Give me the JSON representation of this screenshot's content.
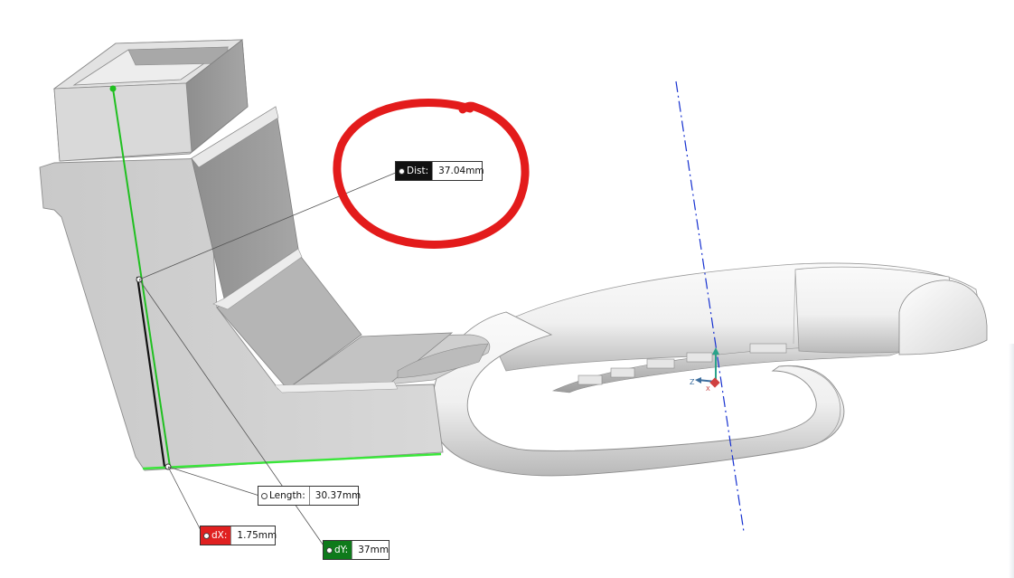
{
  "viewport": {
    "name": "3d-model-view",
    "annotation_color": "#e31b1b",
    "selection_color": "#20c020",
    "axis_color": "#1530d0"
  },
  "measurements": {
    "dist": {
      "label": "Dist:",
      "value": "37.04mm",
      "color": "#111111"
    },
    "length": {
      "label": "Length:",
      "value": "30.37mm",
      "color": "#ffffff"
    },
    "dx": {
      "label": "dX:",
      "value": "1.75mm",
      "color": "#e02020"
    },
    "dy": {
      "label": "dY:",
      "value": "37mm",
      "color": "#0e7a1b"
    }
  },
  "triad": {
    "z_label": "Z",
    "x_label": "X"
  }
}
